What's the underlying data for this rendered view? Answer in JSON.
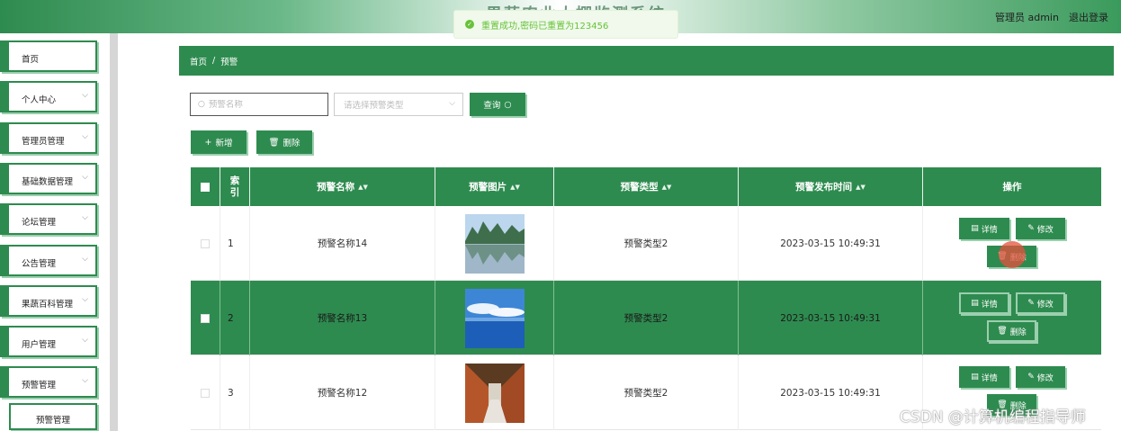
{
  "header": {
    "title": "果蔬农业大棚监测系统",
    "user": "管理员 admin",
    "logout": "退出登录"
  },
  "toast": {
    "message": "重置成功,密码已重置为123456"
  },
  "sidebar": {
    "items": [
      {
        "label": "首页"
      },
      {
        "label": "个人中心"
      },
      {
        "label": "管理员管理"
      },
      {
        "label": "基础数据管理"
      },
      {
        "label": "论坛管理"
      },
      {
        "label": "公告管理"
      },
      {
        "label": "果蔬百科管理"
      },
      {
        "label": "用户管理"
      },
      {
        "label": "预警管理"
      }
    ],
    "sub_item": {
      "label": "预警管理"
    }
  },
  "breadcrumb": {
    "home": "首页",
    "sep": "/",
    "current": "预警"
  },
  "search": {
    "name_placeholder": "预警名称",
    "type_placeholder": "请选择预警类型",
    "query_label": "查询",
    "add_label": "新增",
    "delete_label": "删除"
  },
  "table": {
    "headers": {
      "index": "索引",
      "name": "预警名称",
      "image": "预警图片",
      "type": "预警类型",
      "time": "预警发布时间",
      "ops": "操作"
    },
    "rows": [
      {
        "index": "1",
        "name": "预警名称14",
        "type": "预警类型2",
        "time": "2023-03-15 10:49:31"
      },
      {
        "index": "2",
        "name": "预警名称13",
        "type": "预警类型2",
        "time": "2023-03-15 10:49:31"
      },
      {
        "index": "3",
        "name": "预警名称12",
        "type": "预警类型2",
        "time": "2023-03-15 10:49:31"
      }
    ],
    "ops": {
      "detail": "详情",
      "edit": "修改",
      "delete": "删除"
    }
  },
  "watermark": "CSDN @计算机编程指导师",
  "colors": {
    "primary": "#2e8b4f",
    "accent_shadow": "#9bcfae",
    "success": "#67c23a"
  }
}
